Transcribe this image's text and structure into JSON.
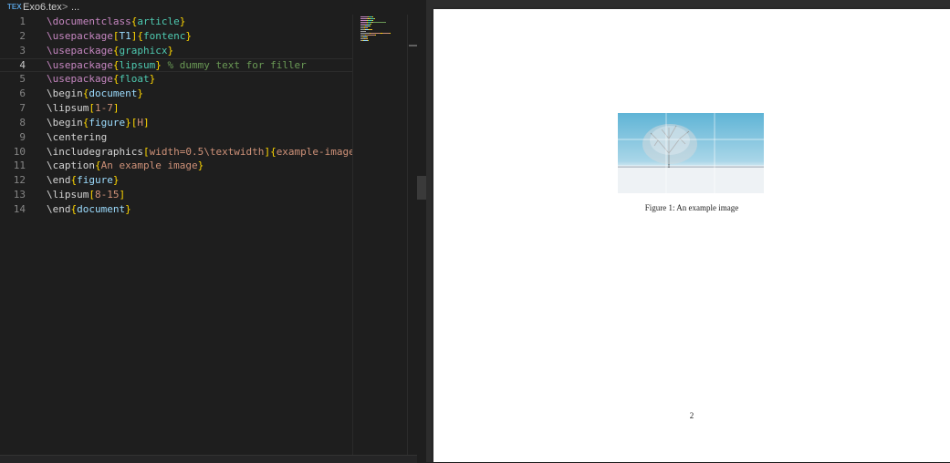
{
  "breadcrumb": {
    "icon": "tex-file-icon",
    "icon_text": "TEX",
    "filename": "Exo6.tex",
    "separator": ">",
    "more": "..."
  },
  "editor": {
    "current_line": 4,
    "lines": [
      {
        "n": "1",
        "parts": [
          [
            "k",
            "\\documentclass"
          ],
          [
            "b",
            "{"
          ],
          [
            "a",
            "article"
          ],
          [
            "b",
            "}"
          ]
        ]
      },
      {
        "n": "2",
        "parts": [
          [
            "k",
            "\\usepackage"
          ],
          [
            "b",
            "["
          ],
          [
            "p",
            "T1"
          ],
          [
            "b",
            "]"
          ],
          [
            "b",
            "{"
          ],
          [
            "a",
            "fontenc"
          ],
          [
            "b",
            "}"
          ]
        ]
      },
      {
        "n": "3",
        "parts": [
          [
            "k",
            "\\usepackage"
          ],
          [
            "b",
            "{"
          ],
          [
            "a",
            "graphicx"
          ],
          [
            "b",
            "}"
          ]
        ]
      },
      {
        "n": "4",
        "parts": [
          [
            "k",
            "\\usepackage"
          ],
          [
            "b",
            "{"
          ],
          [
            "a",
            "lipsum"
          ],
          [
            "b",
            "}"
          ],
          [
            "o",
            " "
          ],
          [
            "c",
            "% dummy text for filler"
          ]
        ]
      },
      {
        "n": "5",
        "parts": [
          [
            "k",
            "\\usepackage"
          ],
          [
            "b",
            "{"
          ],
          [
            "a",
            "float"
          ],
          [
            "b",
            "}"
          ]
        ]
      },
      {
        "n": "6",
        "parts": [
          [
            "o",
            "\\begin"
          ],
          [
            "b",
            "{"
          ],
          [
            "p",
            "document"
          ],
          [
            "b",
            "}"
          ]
        ]
      },
      {
        "n": "7",
        "parts": [
          [
            "o",
            "\\lipsum"
          ],
          [
            "b",
            "["
          ],
          [
            "t",
            "1-7"
          ],
          [
            "b",
            "]"
          ]
        ]
      },
      {
        "n": "8",
        "parts": [
          [
            "o",
            "\\begin"
          ],
          [
            "b",
            "{"
          ],
          [
            "p",
            "figure"
          ],
          [
            "b",
            "}"
          ],
          [
            "b",
            "["
          ],
          [
            "t",
            "H"
          ],
          [
            "b",
            "]"
          ]
        ]
      },
      {
        "n": "9",
        "parts": [
          [
            "o",
            "\\centering"
          ]
        ]
      },
      {
        "n": "10",
        "parts": [
          [
            "o",
            "\\includegraphics"
          ],
          [
            "b",
            "["
          ],
          [
            "t",
            "width=0.5\\textwidth"
          ],
          [
            "b",
            "]"
          ],
          [
            "b",
            "{"
          ],
          [
            "t",
            "example-image"
          ],
          [
            "b",
            "}"
          ]
        ]
      },
      {
        "n": "11",
        "parts": [
          [
            "o",
            "\\caption"
          ],
          [
            "b",
            "{"
          ],
          [
            "t",
            "An example image"
          ],
          [
            "b",
            "}"
          ]
        ]
      },
      {
        "n": "12",
        "parts": [
          [
            "o",
            "\\end"
          ],
          [
            "b",
            "{"
          ],
          [
            "p",
            "figure"
          ],
          [
            "b",
            "}"
          ]
        ]
      },
      {
        "n": "13",
        "parts": [
          [
            "o",
            "\\lipsum"
          ],
          [
            "b",
            "["
          ],
          [
            "t",
            "8-15"
          ],
          [
            "b",
            "]"
          ]
        ]
      },
      {
        "n": "14",
        "parts": [
          [
            "o",
            "\\end"
          ],
          [
            "b",
            "{"
          ],
          [
            "p",
            "document"
          ],
          [
            "b",
            "}"
          ]
        ]
      }
    ]
  },
  "pdf": {
    "caption": "Figure 1: An example image",
    "page_number": "2",
    "image_description_icon": "snowy-tree-image"
  },
  "colors": {
    "editor_bg": "#1e1e1e",
    "keyword": "#c586c0",
    "bracket": "#ffd700",
    "argument": "#4ec9b0",
    "comment": "#6a9955",
    "string": "#ce9178",
    "param": "#9cdcfe"
  }
}
